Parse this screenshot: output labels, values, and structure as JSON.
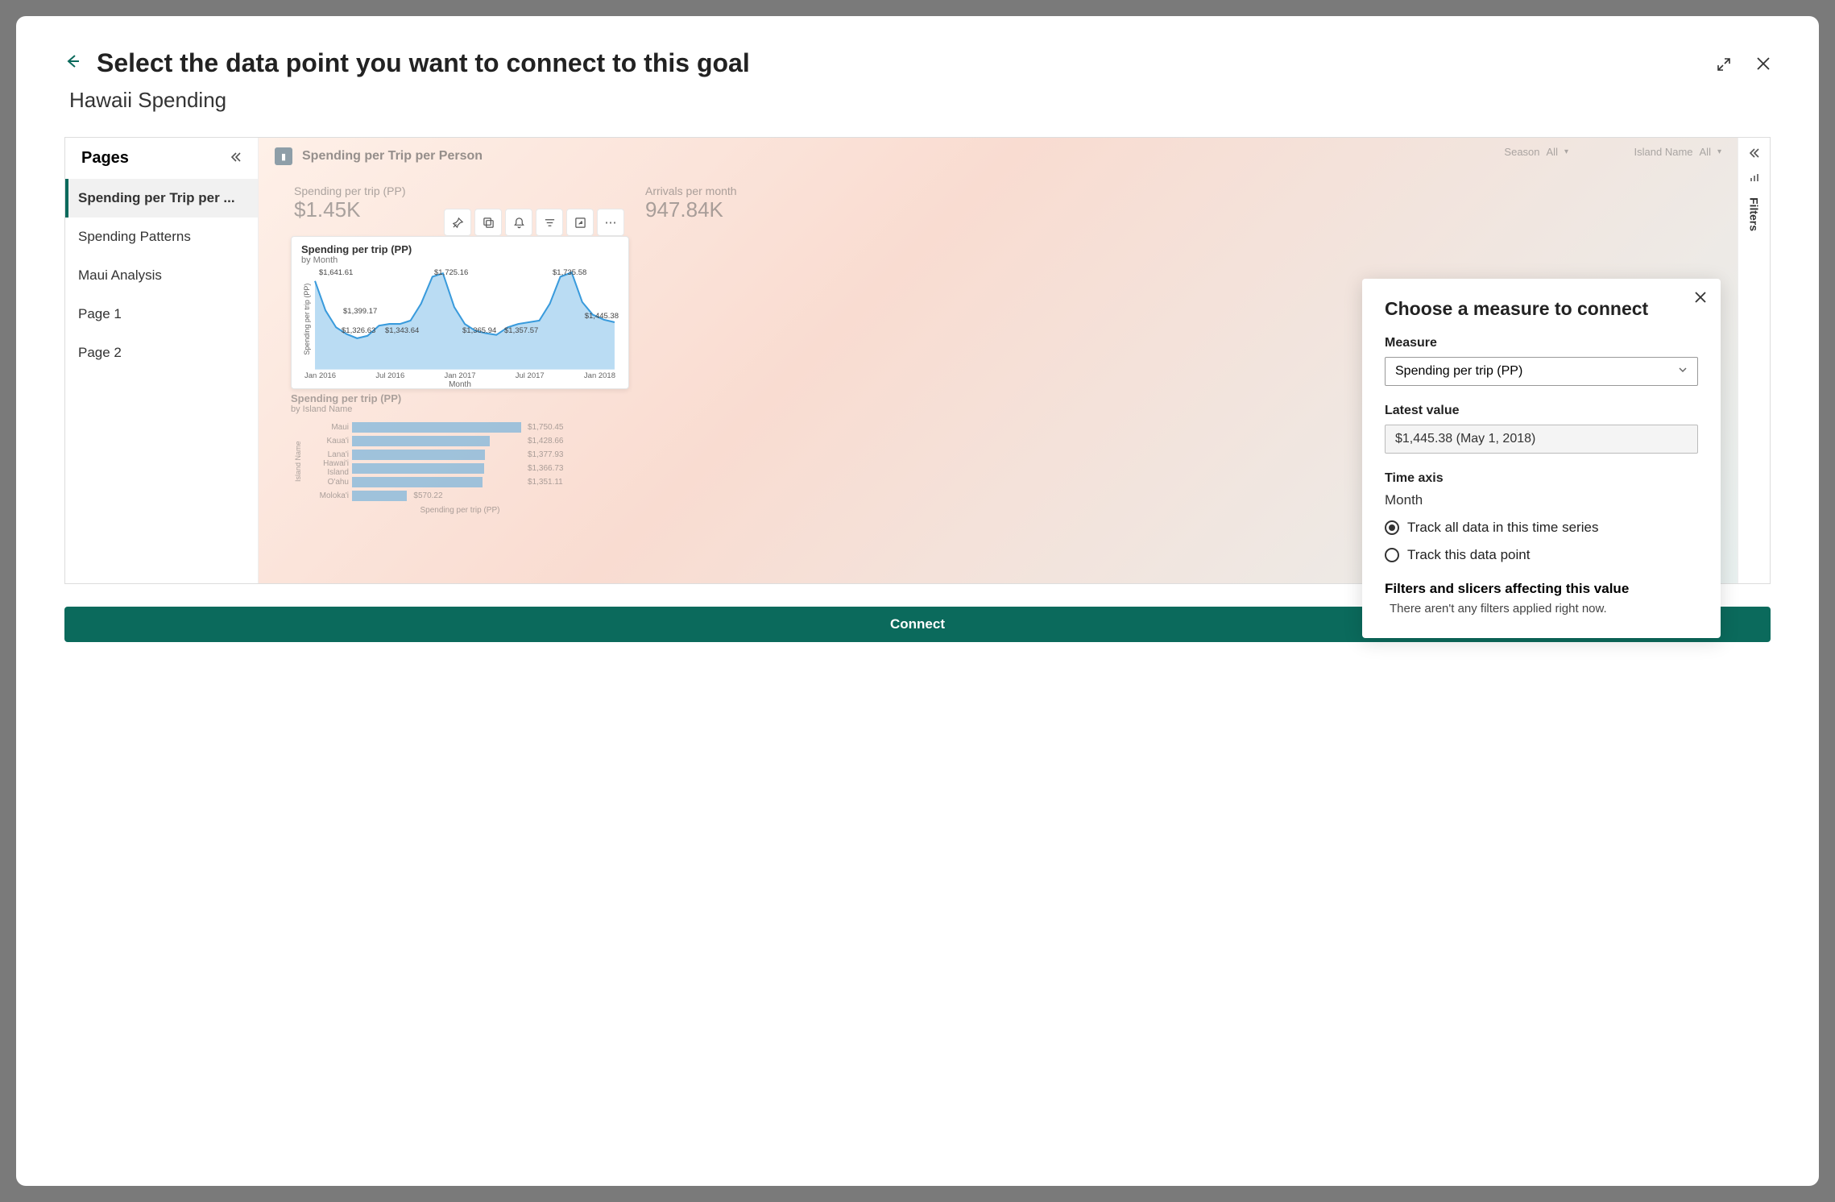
{
  "modal": {
    "title": "Select the data point you want to connect to this goal",
    "subtitle": "Hawaii Spending"
  },
  "pagesPane": {
    "header": "Pages",
    "items": [
      "Spending per Trip per ...",
      "Spending Patterns",
      "Maui Analysis",
      "Page 1",
      "Page 2"
    ],
    "activeIndex": 0
  },
  "reportHeader": {
    "title": "Spending per Trip per Person",
    "slicers": [
      {
        "label": "Season",
        "value": "All"
      },
      {
        "label": "Island Name",
        "value": "All"
      }
    ]
  },
  "kpis": {
    "left": {
      "label": "Spending per trip (PP)",
      "value": "$1.45K"
    },
    "right": {
      "label": "Arrivals per month",
      "value": "947.84K"
    }
  },
  "visualToolbarIcons": [
    "pin-icon",
    "copy-icon",
    "bell-icon",
    "filter-icon",
    "focus-icon",
    "more-icon"
  ],
  "mainChart": {
    "title": "Spending per trip (PP)",
    "sub": "by Month",
    "ylabel": "Spending per trip (PP)",
    "xlabel": "Month",
    "xticks": [
      "Jan 2016",
      "Jul 2016",
      "Jan 2017",
      "Jul 2017",
      "Jan 2018"
    ]
  },
  "barChart": {
    "title": "Spending per trip (PP)",
    "sub": "by Island Name",
    "ylabel": "Island Name",
    "xlabel": "Spending per trip (PP)"
  },
  "filtersRail": {
    "label": "Filters"
  },
  "measurePanel": {
    "title": "Choose a measure to connect",
    "measureLabel": "Measure",
    "measureValue": "Spending per trip (PP)",
    "latestLabel": "Latest value",
    "latestValue": "$1,445.38 (May 1, 2018)",
    "timeAxisLabel": "Time axis",
    "timeAxisValue": "Month",
    "radioAll": "Track all data in this time series",
    "radioPoint": "Track this data point",
    "filtersTitle": "Filters and slicers affecting this value",
    "filtersText": "There aren't any filters applied right now."
  },
  "connectButton": "Connect",
  "chart_data": [
    {
      "type": "line",
      "title": "Spending per trip (PP) by Month",
      "xlabel": "Month",
      "ylabel": "Spending per trip (PP)",
      "x": [
        "Jan 2016",
        "Feb 2016",
        "Mar 2016",
        "Apr 2016",
        "May 2016",
        "Jun 2016",
        "Jul 2016",
        "Aug 2016",
        "Sep 2016",
        "Oct 2016",
        "Nov 2016",
        "Dec 2016",
        "Jan 2017",
        "Feb 2017",
        "Mar 2017",
        "Apr 2017",
        "May 2017",
        "Jun 2017",
        "Jul 2017",
        "Aug 2017",
        "Sep 2017",
        "Oct 2017",
        "Nov 2017",
        "Dec 2017",
        "Jan 2018",
        "Feb 2018",
        "Mar 2018",
        "Apr 2018",
        "May 2018"
      ],
      "values": [
        1641.61,
        1480,
        1390,
        1350,
        1326.63,
        1343.64,
        1399.17,
        1410,
        1410,
        1430,
        1520,
        1680,
        1725.16,
        1520,
        1420,
        1380,
        1365.94,
        1357.57,
        1400,
        1420,
        1430,
        1440,
        1530,
        1680,
        1735.58,
        1560,
        1490,
        1460,
        1445.38
      ],
      "ylim": [
        1250,
        1800
      ],
      "labeled_points": [
        {
          "label": "$1,641.61",
          "x": "Jan 2016"
        },
        {
          "label": "$1,326.63",
          "x": "May 2016"
        },
        {
          "label": "$1,343.64",
          "x": "Jun 2016"
        },
        {
          "label": "$1,399.17",
          "x": "Jul 2016"
        },
        {
          "label": "$1,725.16",
          "x": "Jan 2017"
        },
        {
          "label": "$1,365.94",
          "x": "May 2017"
        },
        {
          "label": "$1,357.57",
          "x": "Jul 2017"
        },
        {
          "label": "$1,735.58",
          "x": "Jan 2018"
        },
        {
          "label": "$1,445.38",
          "x": "May 2018"
        }
      ]
    },
    {
      "type": "bar",
      "orientation": "horizontal",
      "title": "Spending per trip (PP) by Island Name",
      "xlabel": "Spending per trip (PP)",
      "ylabel": "Island Name",
      "categories": [
        "Maui",
        "Kaua'i",
        "Lana'i",
        "Hawai'i Island",
        "O'ahu",
        "Moloka'i"
      ],
      "values": [
        1750.45,
        1428.66,
        1377.93,
        1366.73,
        1351.11,
        570.22
      ]
    }
  ]
}
